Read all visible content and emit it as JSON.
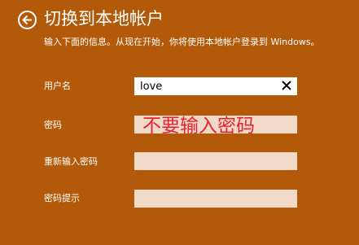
{
  "header": {
    "title": "切换到本地帐户",
    "back_icon": "back-arrow-icon"
  },
  "description": "输入下面的信息。从现在开始，你将使用本地帐户登录到 Windows。",
  "form": {
    "username_label": "用户名",
    "username_value": "love",
    "clear_icon": "close-icon",
    "password_label": "密码",
    "password_value": "",
    "confirm_password_label": "重新输入密码",
    "confirm_password_value": "",
    "password_hint_label": "密码提示",
    "password_hint_value": ""
  },
  "annotation": "不要输入密码",
  "colors": {
    "background": "#b35a0a",
    "input_inactive": "#f0d9c8",
    "annotation": "#e8232f"
  }
}
